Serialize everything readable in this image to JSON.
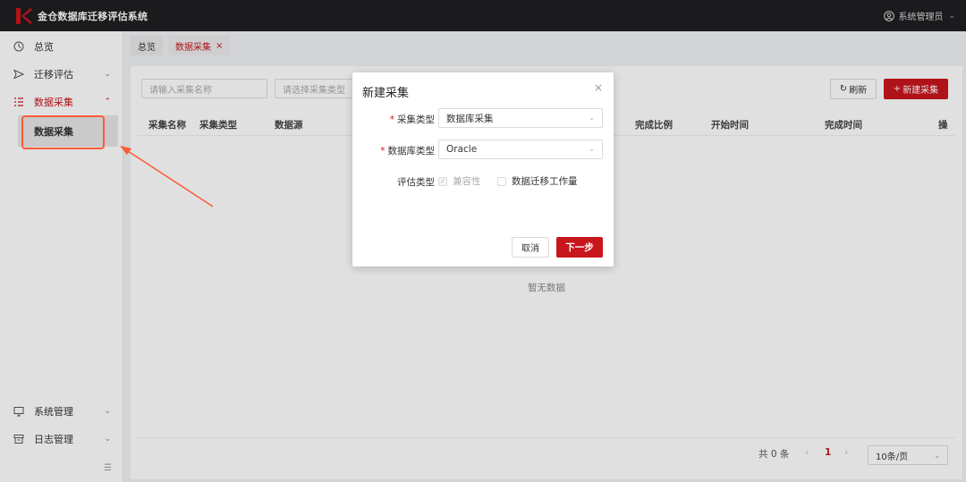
{
  "app": {
    "title": "金仓数据库迁移评估系统",
    "user": "系统管理员"
  },
  "sidebar": {
    "items": [
      {
        "label": "总览",
        "icon": "dashboard-icon"
      },
      {
        "label": "迁移评估",
        "icon": "send-icon"
      },
      {
        "label": "数据采集",
        "icon": "list-icon"
      },
      {
        "label": "系统管理",
        "icon": "monitor-icon"
      },
      {
        "label": "日志管理",
        "icon": "archive-icon"
      }
    ],
    "sub_item": "数据采集"
  },
  "tabs": [
    {
      "label": "总览"
    },
    {
      "label": "数据采集"
    }
  ],
  "toolbar": {
    "name_placeholder": "请输入采集名称",
    "type_placeholder": "请选择采集类型",
    "refresh_label": "刷新",
    "new_label": "新建采集"
  },
  "table": {
    "headers": [
      "采集名称",
      "采集类型",
      "数据源",
      "完成比例",
      "开始时间",
      "完成时间",
      "操"
    ],
    "empty_text": "暂无数据"
  },
  "pagination": {
    "total": "共 0 条",
    "current_page": "1",
    "page_size": "10条/页"
  },
  "modal": {
    "title": "新建采集",
    "fields": {
      "collect_type": {
        "label": "采集类型",
        "value": "数据库采集"
      },
      "db_type": {
        "label": "数据库类型",
        "value": "Oracle"
      },
      "eval_type": {
        "label": "评估类型",
        "options": [
          "兼容性",
          "数据迁移工作量"
        ]
      }
    },
    "cancel_label": "取消",
    "next_label": "下一步"
  },
  "colors": {
    "brand": "#c8161d",
    "topbar": "#1f1f23",
    "annotation": "#ff5a36"
  }
}
